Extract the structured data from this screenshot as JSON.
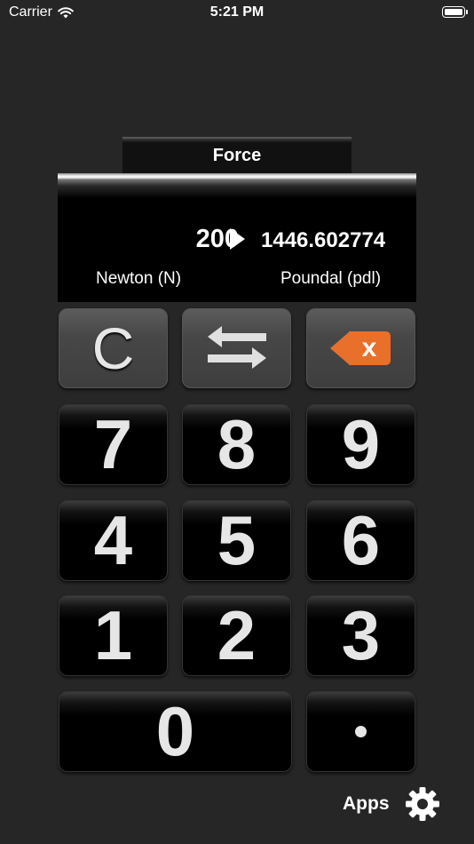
{
  "status_bar": {
    "carrier": "Carrier",
    "time": "5:21 PM"
  },
  "category_tab": {
    "label": "Force"
  },
  "display": {
    "from_value": "200",
    "to_value": "1446.602774",
    "from_unit": "Newton (N)",
    "to_unit": "Poundal (pdl)"
  },
  "keypad": {
    "clear": "C",
    "backspace_glyph": "x",
    "digits": {
      "d7": "7",
      "d8": "8",
      "d9": "9",
      "d4": "4",
      "d5": "5",
      "d6": "6",
      "d1": "1",
      "d2": "2",
      "d3": "3",
      "d0": "0"
    }
  },
  "footer": {
    "apps_label": "Apps",
    "settings_icon": "gear-icon"
  },
  "colors": {
    "background": "#262626",
    "backspace_accent": "#e8702a",
    "key_text": "#e6e6e6"
  }
}
